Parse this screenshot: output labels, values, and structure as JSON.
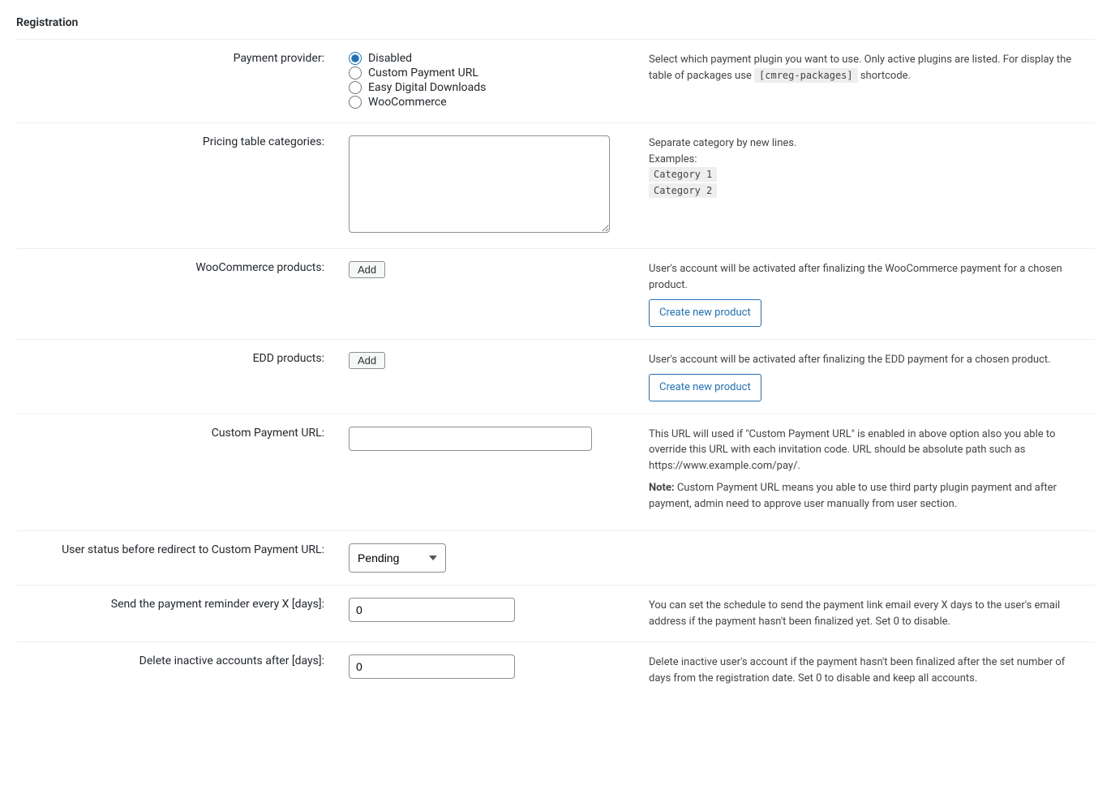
{
  "section_title": "Registration",
  "rows": {
    "payment_provider": {
      "label": "Payment provider:",
      "options": {
        "disabled": "Disabled",
        "custom": "Custom Payment URL",
        "edd": "Easy Digital Downloads",
        "woo": "WooCommerce"
      },
      "desc_a": "Select which payment plugin you want to use. Only active plugins are listed. For display the table of packages use ",
      "shortcode": "[cmreg-packages]",
      "desc_b": " shortcode."
    },
    "pricing_categories": {
      "label": "Pricing table categories:",
      "value": "",
      "desc_head": "Separate category by new lines.",
      "examples_label": "Examples:",
      "ex1": "Category 1",
      "ex2": "Category 2"
    },
    "woo_products": {
      "label": "WooCommerce products:",
      "add_btn": "Add",
      "desc": "User's account will be activated after finalizing the WooCommerce payment for a chosen product.",
      "create_btn": "Create new product"
    },
    "edd_products": {
      "label": "EDD products:",
      "add_btn": "Add",
      "desc": "User's account will be activated after finalizing the EDD payment for a chosen product.",
      "create_btn": "Create new product"
    },
    "custom_url": {
      "label": "Custom Payment URL:",
      "value": "",
      "desc": "This URL will used if \"Custom Payment URL\" is enabled in above option also you able to override this URL with each invitation code. URL should be absolute path such as https://www.example.com/pay/.",
      "note_label": "Note:",
      "note": " Custom Payment URL means you able to use third party plugin payment and after payment, admin need to approve user manually from user section."
    },
    "user_status": {
      "label": "User status before redirect to Custom Payment URL:",
      "selected": "Pending"
    },
    "reminder": {
      "label": "Send the payment reminder every X [days]:",
      "value": "0",
      "desc": "You can set the schedule to send the payment link email every X days to the user's email address if the payment hasn't been finalized yet. Set 0 to disable."
    },
    "delete_inactive": {
      "label": "Delete inactive accounts after [days]:",
      "value": "0",
      "desc": "Delete inactive user's account if the payment hasn't been finalized after the set number of days from the registration date. Set 0 to disable and keep all accounts."
    }
  }
}
